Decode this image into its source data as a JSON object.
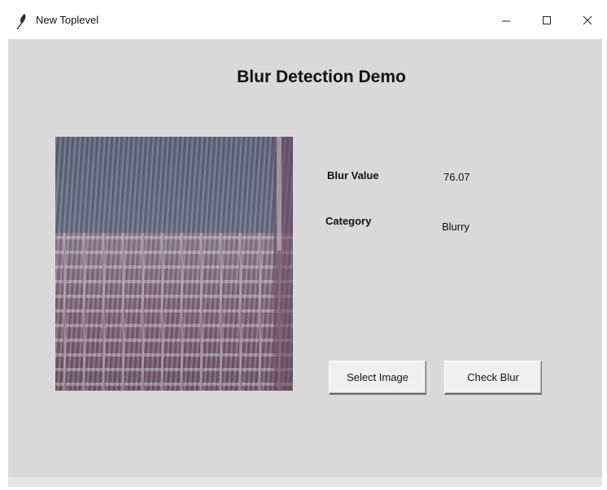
{
  "window": {
    "title": "New Toplevel",
    "controls": [
      "minimize-icon",
      "maximize-icon",
      "close-icon"
    ]
  },
  "app": {
    "heading": "Blur Detection Demo",
    "image_preview": {
      "description_icon": "image-preview"
    },
    "results": {
      "blur_value_label": "Blur Value",
      "blur_value": "76.07",
      "category_label": "Category",
      "category_value": "Blurry"
    },
    "buttons": {
      "select_image": "Select Image",
      "check_blur": "Check Blur"
    }
  },
  "colors": {
    "client_background": "#d9d9d9",
    "button_face": "#f0f0f0",
    "titlebar": "#ffffff"
  }
}
